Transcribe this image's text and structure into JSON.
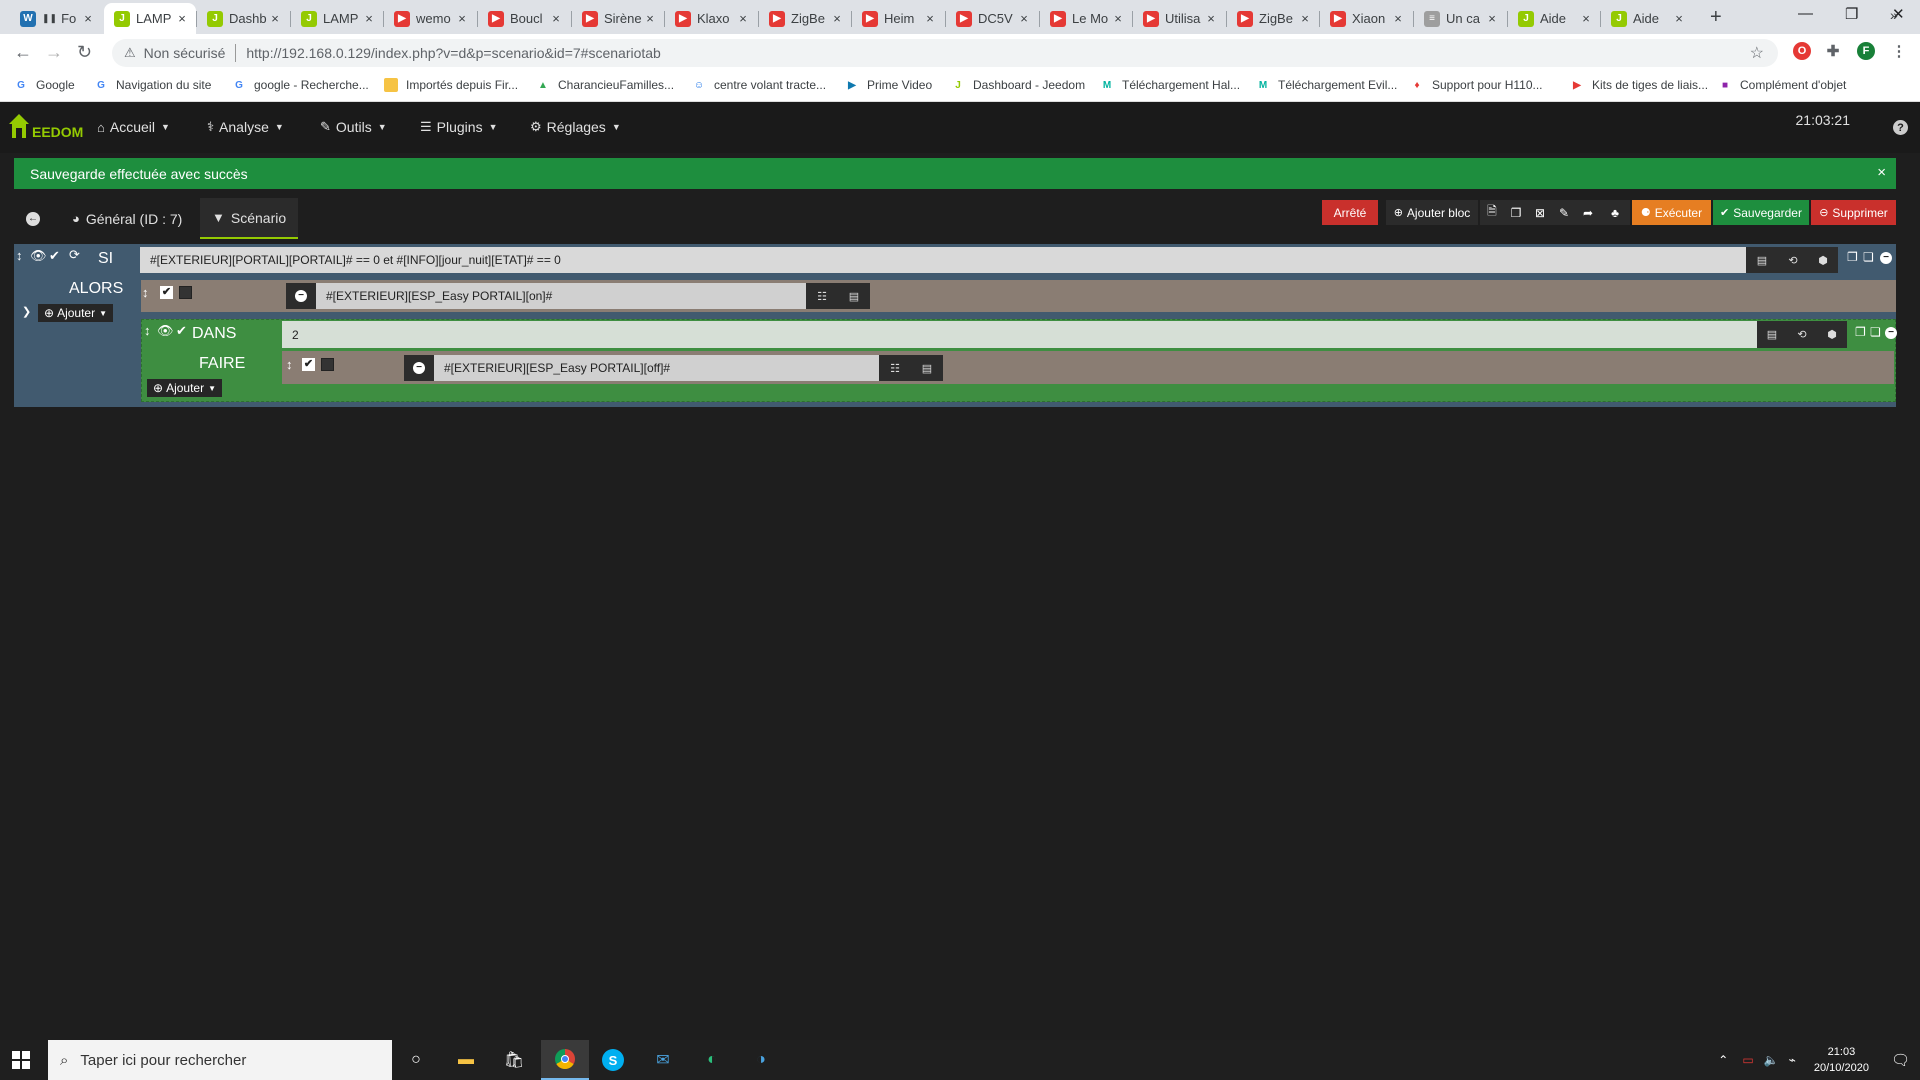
{
  "browser": {
    "tabs": [
      {
        "label": "Fo",
        "pause": "❚❚",
        "fav": "W",
        "color": "#2271b1"
      },
      {
        "label": "LAMP",
        "fav": "J",
        "color": "#94ca02"
      },
      {
        "label": "Dashb",
        "fav": "J",
        "color": "#94ca02"
      },
      {
        "label": "LAMP",
        "fav": "J",
        "color": "#94ca02"
      },
      {
        "label": "wemo",
        "fav": "▶",
        "color": "#e53935"
      },
      {
        "label": "Boucl",
        "fav": "▶",
        "color": "#e53935"
      },
      {
        "label": "Sirène",
        "fav": "▶",
        "color": "#e53935"
      },
      {
        "label": "Klaxo",
        "fav": "▶",
        "color": "#e53935"
      },
      {
        "label": "ZigBe",
        "fav": "▶",
        "color": "#e53935"
      },
      {
        "label": "Heim",
        "fav": "▶",
        "color": "#e53935"
      },
      {
        "label": "DC5V",
        "fav": "▶",
        "color": "#e53935"
      },
      {
        "label": "Le Mo",
        "fav": "▶",
        "color": "#e53935"
      },
      {
        "label": "Utilisa",
        "fav": "▶",
        "color": "#e53935"
      },
      {
        "label": "ZigBe",
        "fav": "▶",
        "color": "#e53935"
      },
      {
        "label": "Xiaon",
        "fav": "▶",
        "color": "#e53935"
      },
      {
        "label": "Un ca",
        "fav": "≡",
        "color": "#9e9e9e"
      },
      {
        "label": "Aide",
        "fav": "J",
        "color": "#94ca02"
      },
      {
        "label": "Aide",
        "fav": "J",
        "color": "#94ca02"
      }
    ],
    "tab_close": "×",
    "new_tab": "+",
    "window": {
      "minimize": "—",
      "restore": "❐",
      "close": "✕"
    },
    "nav": {
      "back": "←",
      "forward": "→",
      "reload": "↻"
    },
    "insecure_label": "Non sécurisé",
    "url": "http://192.168.0.129/index.php?v=d&p=scenario&id=7#scenariotab",
    "star": "☆",
    "profile_initial": "F",
    "bookmarks": [
      {
        "label": "Google",
        "fav": "G",
        "color": "#4285f4"
      },
      {
        "label": "Navigation du site",
        "fav": "G",
        "color": "#4285f4"
      },
      {
        "label": "google - Recherche...",
        "fav": "G",
        "color": "#4285f4"
      },
      {
        "label": "Importés depuis Fir...",
        "fav": "",
        "color": "#f6c344"
      },
      {
        "label": "CharancieuFamilles...",
        "fav": "▲",
        "color": "#34a853"
      },
      {
        "label": "centre volant tracte...",
        "fav": "☺",
        "color": "#1a73e8"
      },
      {
        "label": "Prime Video",
        "fav": "▶",
        "color": "#0f79af"
      },
      {
        "label": "Dashboard - Jeedom",
        "fav": "J",
        "color": "#94ca02"
      },
      {
        "label": "Téléchargement Hal...",
        "fav": "M",
        "color": "#00b39f"
      },
      {
        "label": "Téléchargement Evil...",
        "fav": "M",
        "color": "#00b39f"
      },
      {
        "label": "Support pour H110...",
        "fav": "♦",
        "color": "#e53935"
      },
      {
        "label": "Kits de tiges de liais...",
        "fav": "▶",
        "color": "#e53935"
      },
      {
        "label": "Complément d'objet",
        "fav": "■",
        "color": "#8e24aa"
      }
    ],
    "bookmarks_more": "»"
  },
  "jeedom": {
    "logo_text": "EEDOM",
    "menu": [
      {
        "label": "Accueil",
        "icon": "⌂"
      },
      {
        "label": "Analyse",
        "icon": "⚕"
      },
      {
        "label": "Outils",
        "icon": "✎"
      },
      {
        "label": "Plugins",
        "icon": "☰"
      },
      {
        "label": "Réglages",
        "icon": "⚙"
      }
    ],
    "clock": "21:03:21",
    "help": "?",
    "alert": "Sauvegarde effectuée avec succès",
    "alert_close": "×",
    "tabs": {
      "back_icon": "➜",
      "general": "Général (ID : 7)",
      "scenario": "Scénario"
    },
    "toolbar": {
      "status": "Arrêté",
      "add_block": "Ajouter bloc",
      "execute": "Exécuter",
      "save": "Sauvegarder",
      "delete": "Supprimer"
    },
    "colors": {
      "status": "#c9302c",
      "execute": "#e67e22",
      "save": "#1e8e3e",
      "delete": "#c9302c",
      "si_block": "#415a6f",
      "dans_block": "#3e8e41",
      "accent": "#94ca02"
    },
    "scenario": {
      "si_label": "SI",
      "si_condition": "#[EXTERIEUR][PORTAIL][PORTAIL]# == 0  et #[INFO][jour_nuit][ETAT]# == 0",
      "alors_label": "ALORS",
      "alors_action": "#[EXTERIEUR][ESP_Easy PORTAIL][on]#",
      "add_label": "Ajouter",
      "dans_label": "DANS",
      "dans_value": "2",
      "faire_label": "FAIRE",
      "faire_action": "#[EXTERIEUR][ESP_Easy PORTAIL][off]#",
      "faire_add_label": "Ajouter"
    }
  },
  "taskbar": {
    "search_placeholder": "Taper ici pour rechercher",
    "time": "21:03",
    "date": "20/10/2020"
  }
}
